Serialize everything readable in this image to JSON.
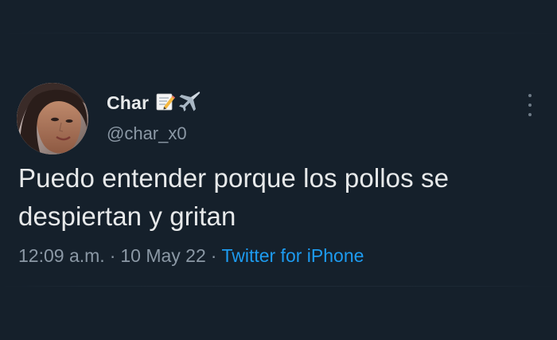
{
  "tweet": {
    "author": {
      "display_name": "Char",
      "handle": "@char_x0",
      "name_emojis": [
        "memo-emoji",
        "airplane-emoji"
      ]
    },
    "text_line1": "Puedo entender porque los pollos se",
    "text_line2": "despiertan y gritan",
    "time": "12:09 a.m.",
    "date": "10 May 22",
    "separator": "·",
    "source": "Twitter for iPhone"
  },
  "colors": {
    "background": "#15202b",
    "primary_text": "#e7e9ea",
    "secondary_text": "#8b98a5",
    "link": "#1d9bf0"
  }
}
